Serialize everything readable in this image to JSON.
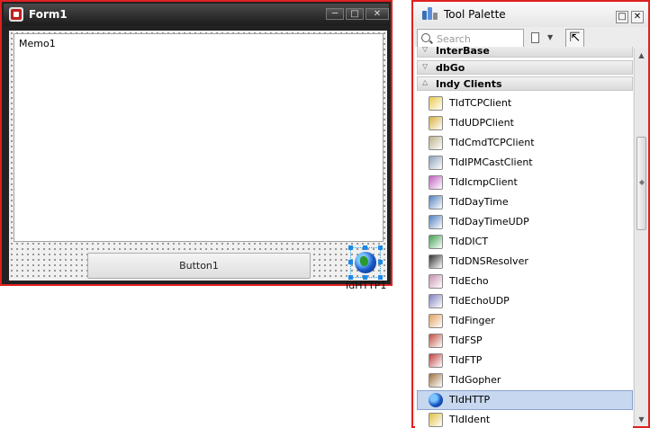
{
  "form": {
    "title": "Form1",
    "memo_text": "Memo1",
    "button_label": "Button1",
    "component_label": "IdHTTP1",
    "caption_buttons": [
      "minimize",
      "maximize",
      "close"
    ]
  },
  "palette": {
    "title": "Tool Palette",
    "search_placeholder": "Search",
    "categories": [
      {
        "label": "InterBase",
        "state": "collapsed"
      },
      {
        "label": "dbGo",
        "state": "collapsed"
      },
      {
        "label": "Indy Clients",
        "state": "expanded"
      }
    ],
    "items": [
      {
        "label": "TIdTCPClient",
        "icon": "tcp-client-icon",
        "color": "#e8c84a"
      },
      {
        "label": "TIdUDPClient",
        "icon": "udp-client-icon",
        "color": "#d8b040"
      },
      {
        "label": "TIdCmdTCPClient",
        "icon": "cmd-tcp-client-icon",
        "color": "#b8b088"
      },
      {
        "label": "TIdIPMCastClient",
        "icon": "ipmcast-client-icon",
        "color": "#8aa0b8"
      },
      {
        "label": "TIdIcmpClient",
        "icon": "icmp-client-icon",
        "color": "#c060c0"
      },
      {
        "label": "TIdDayTime",
        "icon": "daytime-icon",
        "color": "#5080c0"
      },
      {
        "label": "TIdDayTimeUDP",
        "icon": "daytime-udp-icon",
        "color": "#5080c0"
      },
      {
        "label": "TIdDICT",
        "icon": "dict-icon",
        "color": "#40a050"
      },
      {
        "label": "TIdDNSResolver",
        "icon": "dns-resolver-icon",
        "color": "#303030"
      },
      {
        "label": "TIdEcho",
        "icon": "echo-icon",
        "color": "#c890b0"
      },
      {
        "label": "TIdEchoUDP",
        "icon": "echo-udp-icon",
        "color": "#8080c0"
      },
      {
        "label": "TIdFinger",
        "icon": "finger-icon",
        "color": "#e0a060"
      },
      {
        "label": "TIdFSP",
        "icon": "fsp-icon",
        "color": "#c05040"
      },
      {
        "label": "TIdFTP",
        "icon": "ftp-icon",
        "color": "#c04040"
      },
      {
        "label": "TIdGopher",
        "icon": "gopher-icon",
        "color": "#a07040"
      },
      {
        "label": "TIdHTTP",
        "icon": "http-globe-icon",
        "color": "#1a58c8",
        "selected": true
      },
      {
        "label": "TIdIdent",
        "icon": "ident-icon",
        "color": "#e0c040"
      }
    ]
  }
}
